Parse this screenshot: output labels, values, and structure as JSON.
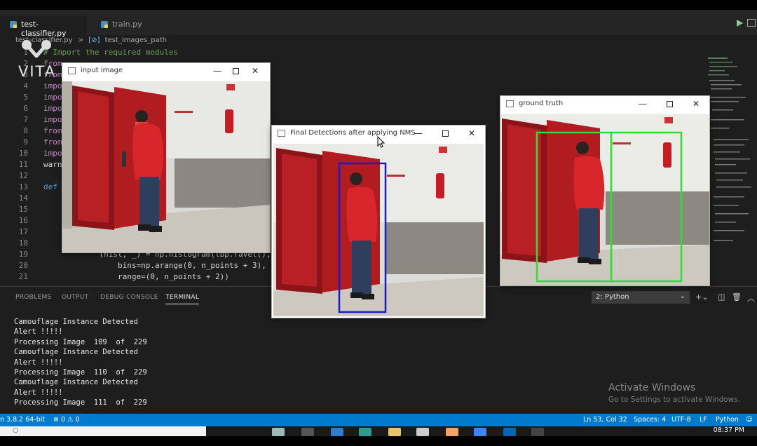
{
  "tabs": [
    {
      "label": "test-classifier.py",
      "active": true
    },
    {
      "label": "train.py",
      "active": false
    }
  ],
  "breadcrumb": {
    "file": "test-classifier.py",
    "separator": ">",
    "symbol": "test_images_path"
  },
  "watermark": {
    "text": "VITA"
  },
  "code_lines": [
    {
      "n": "1",
      "text": "# Import the required modules",
      "style": "comment"
    },
    {
      "n": "2",
      "text": "from",
      "style": "kw"
    },
    {
      "n": "3",
      "text": "from",
      "style": "kw"
    },
    {
      "n": "4",
      "text": "impo",
      "style": "kw"
    },
    {
      "n": "5",
      "text": "impo",
      "style": "kw"
    },
    {
      "n": "6",
      "text": "impo",
      "style": "kw"
    },
    {
      "n": "7",
      "text": "impo",
      "style": "kw"
    },
    {
      "n": "8",
      "text": "from",
      "style": "kw"
    },
    {
      "n": "9",
      "text": "from",
      "style": "kw"
    },
    {
      "n": "10",
      "text": "impo",
      "style": "kw"
    },
    {
      "n": "11",
      "text": "warn",
      "style": "plain"
    },
    {
      "n": "12",
      "text": "",
      "style": "plain"
    },
    {
      "n": "13",
      "text": "def",
      "style": "def"
    },
    {
      "n": "14",
      "text": "",
      "style": "plain"
    },
    {
      "n": "15",
      "text": "",
      "style": "plain"
    },
    {
      "n": "16",
      "text": "",
      "style": "plain"
    },
    {
      "n": "17",
      "text": "",
      "style": "plain"
    },
    {
      "n": "18",
      "text": "",
      "style": "plain"
    },
    {
      "n": "19",
      "text": "            (hist, _) = np.histogram(lbp.ravel(),",
      "style": "plain"
    },
    {
      "n": "20",
      "text": "                bins=np.arange(0, n_points + 3),",
      "style": "plain"
    },
    {
      "n": "21",
      "text": "                range=(0, n_points + 2))",
      "style": "plain"
    }
  ],
  "panel": {
    "tabs": [
      "PROBLEMS",
      "OUTPUT",
      "DEBUG CONSOLE",
      "TERMINAL"
    ],
    "active_tab": "TERMINAL",
    "terminal_select": "2: Python",
    "terminal_lines": [
      "Camouflage Instance Detected",
      "Alert !!!!!",
      "Processing Image  109  of  229",
      "Camouflage Instance Detected",
      "Alert !!!!!",
      "Processing Image  110  of  229",
      "Camouflage Instance Detected",
      "Alert !!!!!",
      "Processing Image  111  of  229"
    ]
  },
  "activate_windows": {
    "title": "Activate Windows",
    "subtitle": "Go to Settings to activate Windows."
  },
  "statusbar": {
    "python": "n 3.8.2 64-bit",
    "problems": "⊗ 0 ⚠ 0",
    "position": "Ln 53, Col 32",
    "spaces": "Spaces: 4",
    "encoding": "UTF-8",
    "eol": "LF",
    "language": "Python"
  },
  "clock": "08:37 PM",
  "windows": {
    "input": {
      "title": "input image"
    },
    "detections": {
      "title": "Final Detections after applying NMS"
    },
    "ground_truth": {
      "title": "ground truth"
    }
  },
  "window_buttons": {
    "minimize": "—",
    "close": "✕"
  },
  "colors": {
    "detection_box": "#1a1acc",
    "ground_truth_box": "#33dd33",
    "accent": "#007acc"
  }
}
